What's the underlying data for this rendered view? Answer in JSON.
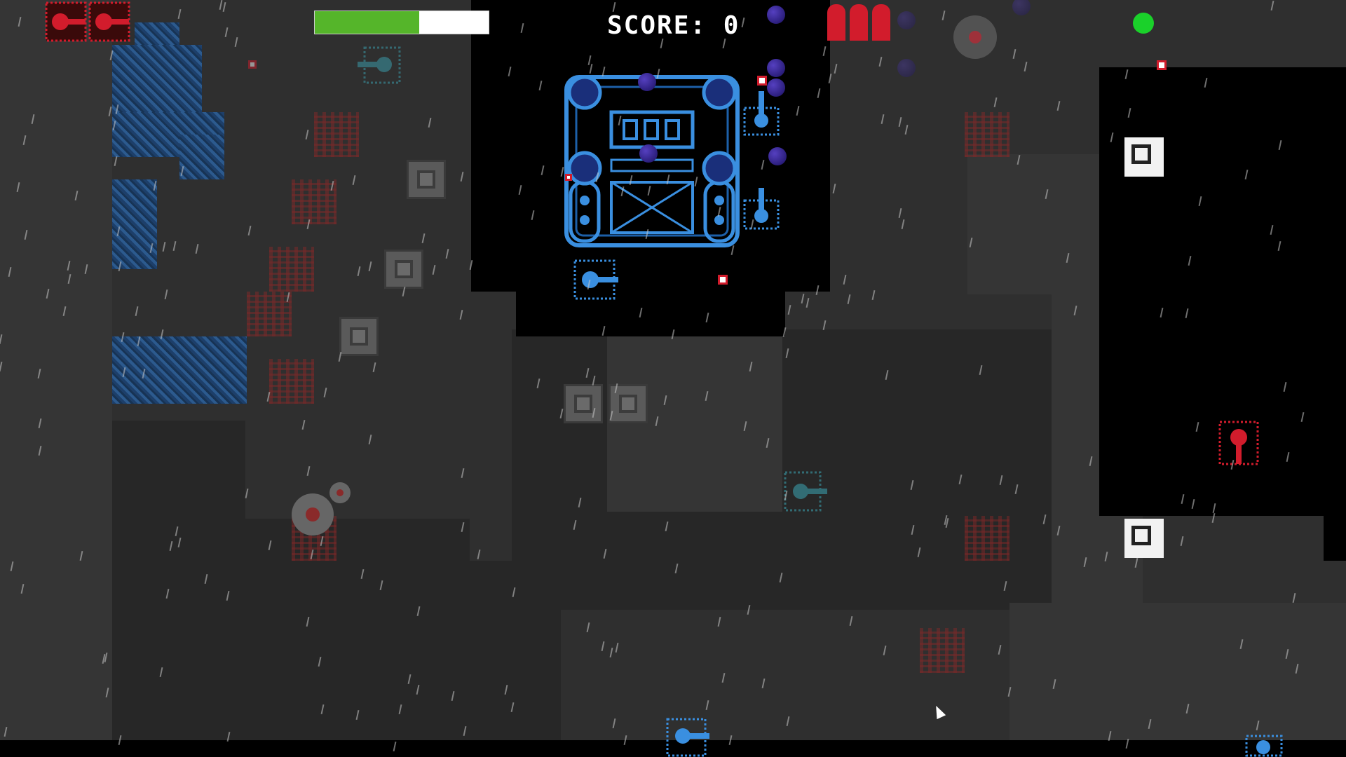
{
  "hud": {
    "score_label": "SCORE: 0",
    "health_fraction": 0.6,
    "lives_remaining": 2,
    "ammo_shells": 3,
    "status_indicator_color": "#1ad12a"
  },
  "colors": {
    "player": "#3a8fe0",
    "enemy": "#d21c2c",
    "health_fill": "#55b52a",
    "health_empty": "#ffffff",
    "background": "#2f2f2f",
    "fog": "#000000"
  },
  "entities": {
    "boss_fortress": "blue-fortress-icon",
    "enemy_tank": "red-tank-icon",
    "ally_tank": "blue-tank-icon",
    "mine": "mine-icon",
    "crate": "steel-crate-icon",
    "cursor": "mouse-cursor-icon"
  }
}
